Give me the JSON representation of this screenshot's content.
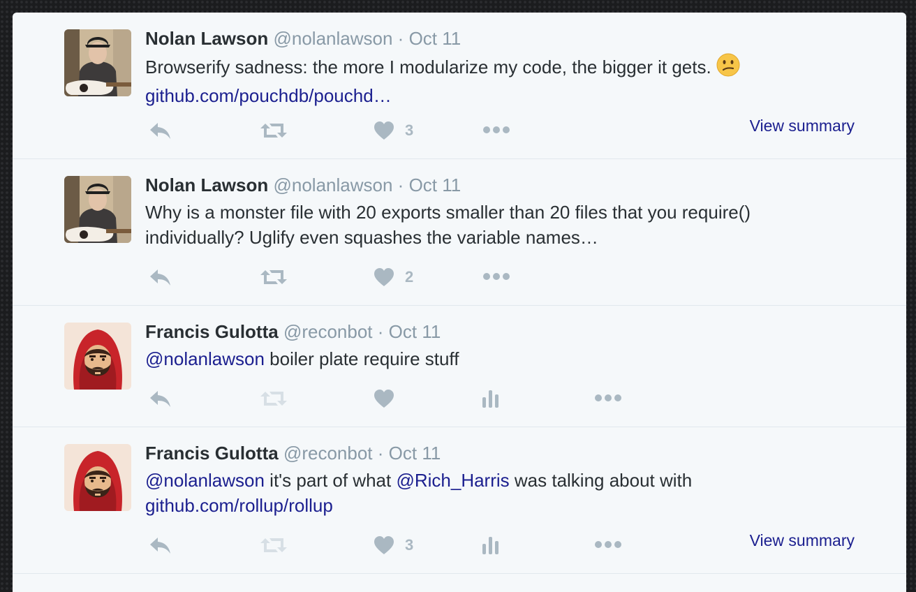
{
  "tweets": [
    {
      "fullname": "Nolan Lawson",
      "handle": "@nolanlawson",
      "separator": "·",
      "date": "Oct 11",
      "text": "Browserify sadness: the more I modularize my code, the bigger it gets.",
      "emoji": "confused-face",
      "link": "github.com/pouchdb/pouchd…",
      "like_count": "3",
      "view_summary": "View summary"
    },
    {
      "fullname": "Nolan Lawson",
      "handle": "@nolanlawson",
      "separator": "·",
      "date": "Oct 11",
      "text": "Why is a monster file with 20 exports smaller than 20 files that you require() individually? Uglify even squashes the variable names…",
      "like_count": "2"
    },
    {
      "fullname": "Francis Gulotta",
      "handle": "@reconbot",
      "separator": "·",
      "date": "Oct 11",
      "mention": "@nolanlawson",
      "text": " boiler plate require stuff",
      "like_count": ""
    },
    {
      "fullname": "Francis Gulotta",
      "handle": "@reconbot",
      "separator": "·",
      "date": "Oct 11",
      "mention": "@nolanlawson",
      "text_part1": " it's part of what ",
      "mention2": "@Rich_Harris",
      "text_part2": " was talking about with",
      "link": "github.com/rollup/rollup",
      "like_count": "3",
      "view_summary": "View summary"
    }
  ],
  "colors": {
    "background": "#1b1c1e",
    "panel": "#f5f8fa",
    "text": "#292f33",
    "muted": "#8899a6",
    "icon": "#aab8c2",
    "link": "#1b1f8f"
  },
  "icons": [
    "reply-icon",
    "retweet-icon",
    "heart-icon",
    "more-icon",
    "analytics-icon"
  ]
}
